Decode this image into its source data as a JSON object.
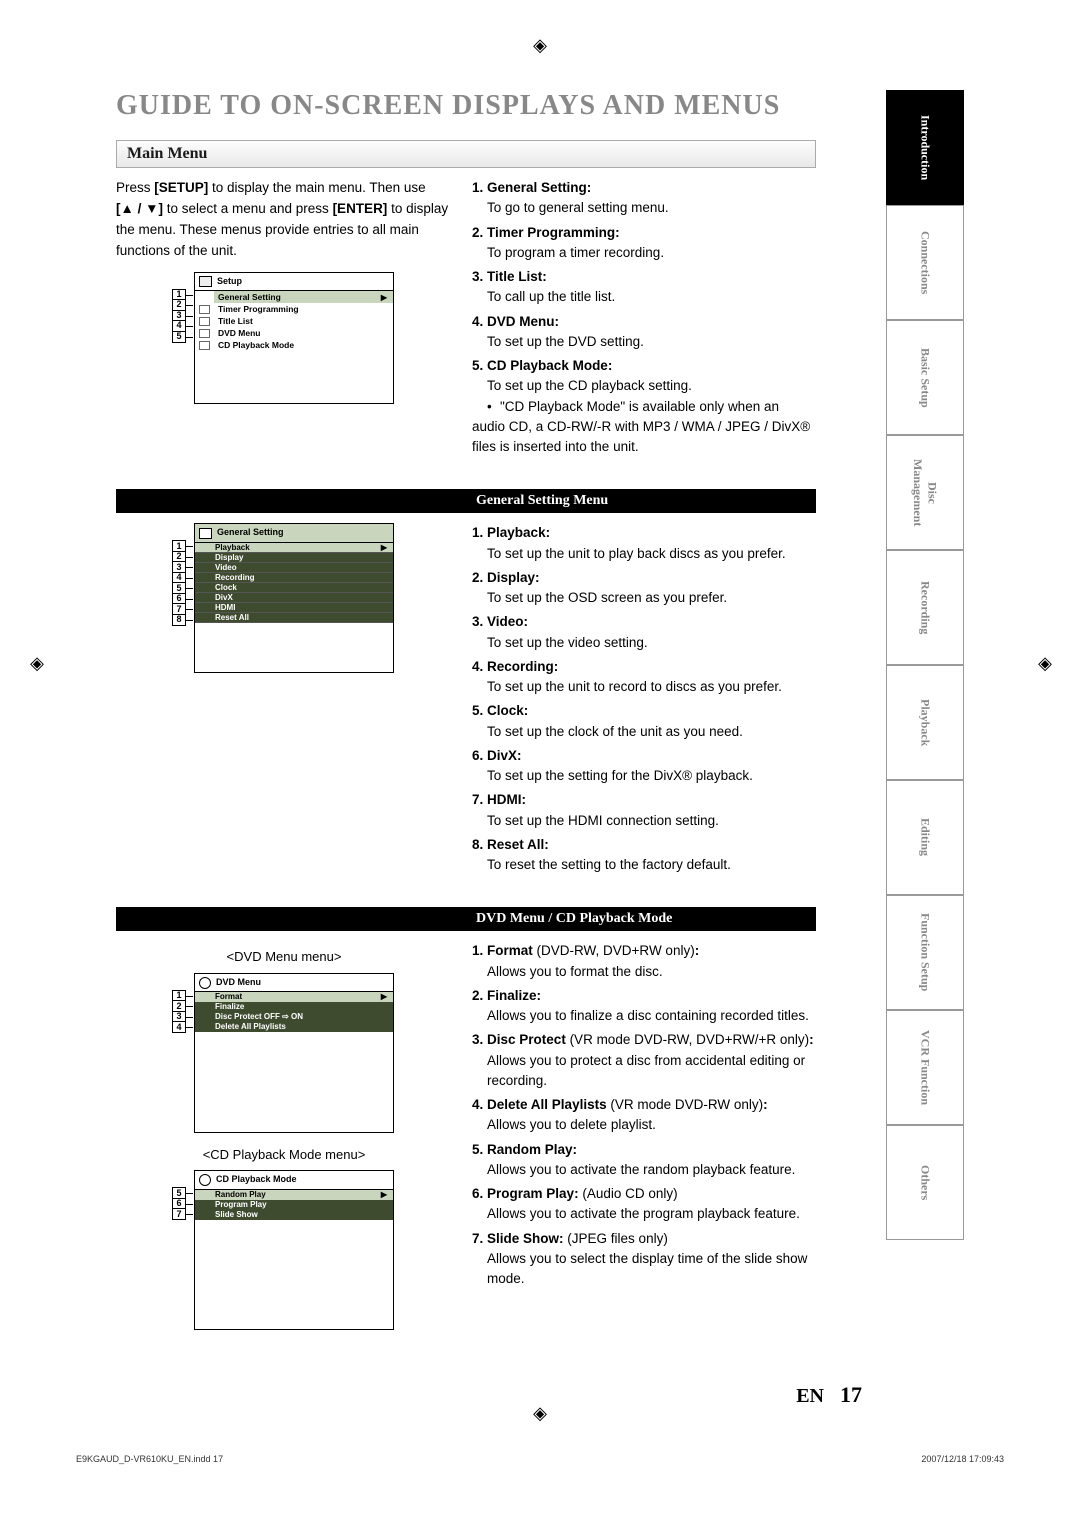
{
  "page_title": "GUIDE TO ON-SCREEN DISPLAYS AND MENUS",
  "section_main": "Main Menu",
  "intro": {
    "line1": "Press ",
    "setup": "[SETUP]",
    "line2": " to display the main menu. Then use ",
    "arrows": "[▲ / ▼]",
    "line3": " to select a menu and press ",
    "enter": "[ENTER]",
    "line4": " to display the menu. These menus provide entries to all main functions of the unit."
  },
  "setup_menu": {
    "title": "Setup",
    "items": [
      "General Setting",
      "Timer Programming",
      "Title List",
      "DVD Menu",
      "CD Playback Mode"
    ],
    "callouts": [
      "1",
      "2",
      "3",
      "4",
      "5"
    ]
  },
  "main_items": [
    {
      "num": "1.",
      "label": "General Setting:",
      "desc": "To go to general setting menu."
    },
    {
      "num": "2.",
      "label": "Timer Programming:",
      "desc": "To program a timer recording."
    },
    {
      "num": "3.",
      "label": "Title List:",
      "desc": "To call up the title list."
    },
    {
      "num": "4.",
      "label": "DVD Menu:",
      "desc": "To set up the DVD setting."
    },
    {
      "num": "5.",
      "label": "CD Playback Mode:",
      "desc": "To set up the CD playback setting.",
      "sub": "\"CD Playback Mode\" is available only when an audio CD, a CD-RW/-R with MP3 / WMA / JPEG / DivX® files is inserted into the unit."
    }
  ],
  "gs_header": "General Setting Menu",
  "gs_menu": {
    "title": "General Setting",
    "items": [
      "Playback",
      "Display",
      "Video",
      "Recording",
      "Clock",
      "DivX",
      "HDMI",
      "Reset All"
    ],
    "callouts": [
      "1",
      "2",
      "3",
      "4",
      "5",
      "6",
      "7",
      "8"
    ]
  },
  "gs_items": [
    {
      "num": "1.",
      "label": "Playback:",
      "desc": "To set up the unit to play back discs as you prefer."
    },
    {
      "num": "2.",
      "label": "Display:",
      "desc": "To set up the OSD screen as you prefer."
    },
    {
      "num": "3.",
      "label": "Video:",
      "desc": "To set up the video setting."
    },
    {
      "num": "4.",
      "label": "Recording:",
      "desc": "To set up the unit to record to discs as you prefer."
    },
    {
      "num": "5.",
      "label": "Clock:",
      "desc": "To set up the clock of the unit as you need."
    },
    {
      "num": "6.",
      "label": "DivX:",
      "desc": "To set up the setting for the DivX® playback."
    },
    {
      "num": "7.",
      "label": "HDMI:",
      "desc": "To set up the HDMI connection setting."
    },
    {
      "num": "8.",
      "label": "Reset All:",
      "desc": "To reset the setting to the factory default."
    }
  ],
  "dvd_header": "DVD Menu / CD Playback Mode",
  "dvd_caption": "<DVD Menu menu>",
  "cd_caption": "<CD Playback Mode menu>",
  "dvd_menu": {
    "title": "DVD Menu",
    "items": [
      "Format",
      "Finalize",
      "Disc Protect OFF ⇨ ON",
      "Delete All Playlists"
    ],
    "callouts": [
      "1",
      "2",
      "3",
      "4"
    ]
  },
  "cd_menu": {
    "title": "CD Playback Mode",
    "items": [
      "Random Play",
      "Program Play",
      "Slide Show"
    ],
    "callouts": [
      "5",
      "6",
      "7"
    ]
  },
  "dvd_items": [
    {
      "num": "1.",
      "label": "Format",
      "qual": " (DVD-RW, DVD+RW only)",
      "colon": ":",
      "desc": "Allows you to format the disc."
    },
    {
      "num": "2.",
      "label": "Finalize:",
      "qual": "",
      "colon": "",
      "desc": "Allows you to finalize a disc containing recorded titles."
    },
    {
      "num": "3.",
      "label": "Disc Protect",
      "qual": " (VR mode DVD-RW, DVD+RW/+R only)",
      "colon": ":",
      "desc": "Allows you to protect a disc from accidental editing or recording."
    },
    {
      "num": "4.",
      "label": "Delete All Playlists",
      "qual": " (VR mode DVD-RW only)",
      "colon": ":",
      "desc": "Allows you to delete playlist."
    },
    {
      "num": "5.",
      "label": "Random Play:",
      "qual": "",
      "colon": "",
      "desc": "Allows you to activate the random playback feature."
    },
    {
      "num": "6.",
      "label": "Program Play:",
      "qual": " (Audio CD only)",
      "colon": "",
      "desc": "Allows you to activate the program playback feature."
    },
    {
      "num": "7.",
      "label": "Slide Show:",
      "qual": " (JPEG files only)",
      "colon": "",
      "desc": "Allows you to select the display time of the slide show mode."
    }
  ],
  "tabs": [
    "Introduction",
    "Connections",
    "Basic Setup",
    "Disc Management",
    "Recording",
    "Playback",
    "Editing",
    "Function Setup",
    "VCR Function",
    "Others"
  ],
  "footer": {
    "lang": "EN",
    "page": "17"
  },
  "meta": {
    "left": "E9KGAUD_D-VR610KU_EN.indd   17",
    "right": "2007/12/18   17:09:43"
  }
}
